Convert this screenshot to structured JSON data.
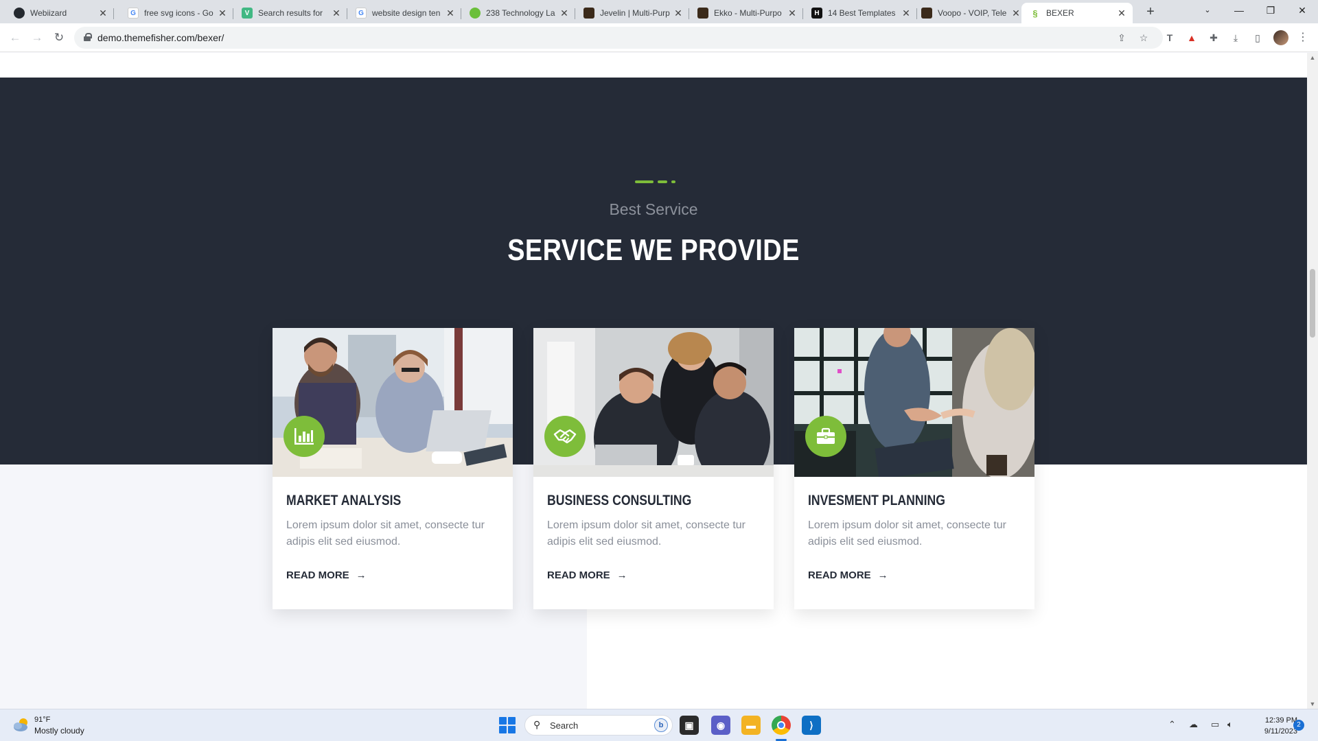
{
  "browser": {
    "tabs": [
      {
        "title": "Webiizard",
        "icon": "github-icon",
        "color": "#24292f"
      },
      {
        "title": "free svg icons - Go",
        "icon": "google-icon",
        "color": "#4285f4"
      },
      {
        "title": "Search results for",
        "icon": "vuejs-icon",
        "color": "#41b883"
      },
      {
        "title": "website design ten",
        "icon": "google-icon",
        "color": "#4285f4"
      },
      {
        "title": "238 Technology La",
        "icon": "leaf-icon",
        "color": "#6bbf3a"
      },
      {
        "title": "Jevelin | Multi-Purp",
        "icon": "themeforest-icon",
        "color": "#3b2a1a"
      },
      {
        "title": "Ekko - Multi-Purpo",
        "icon": "themeforest-icon",
        "color": "#3b2a1a"
      },
      {
        "title": "14 Best Templates",
        "icon": "h-icon",
        "color": "#111111"
      },
      {
        "title": "Voopo - VOIP, Tele",
        "icon": "themeforest-icon",
        "color": "#3b2a1a"
      },
      {
        "title": "BEXER",
        "icon": "bexer-icon",
        "color": "#7ebd3a"
      }
    ],
    "url": "demo.themefisher.com/bexer/"
  },
  "section": {
    "subtitle": "Best Service",
    "heading": "SERVICE WE PROVIDE",
    "accent_color": "#7ebd3a",
    "dark_bg": "#252b37"
  },
  "cards": [
    {
      "title": "MARKET ANALYSIS",
      "text": "Lorem ipsum dolor sit amet, consecte tur adipis elit sed eiusmod.",
      "link": "READ MORE",
      "icon": "bar-chart-icon"
    },
    {
      "title": "BUSINESS CONSULTING",
      "text": "Lorem ipsum dolor sit amet, consecte tur adipis elit sed eiusmod.",
      "link": "READ MORE",
      "icon": "handshake-icon"
    },
    {
      "title": "INVESMENT PLANNING",
      "text": "Lorem ipsum dolor sit amet, consecte tur adipis elit sed eiusmod.",
      "link": "READ MORE",
      "icon": "briefcase-icon"
    }
  ],
  "taskbar": {
    "temperature": "91°F",
    "weather": "Mostly cloudy",
    "search_placeholder": "Search",
    "time": "12:39 PM",
    "date": "9/11/2023",
    "notifications": "2"
  }
}
